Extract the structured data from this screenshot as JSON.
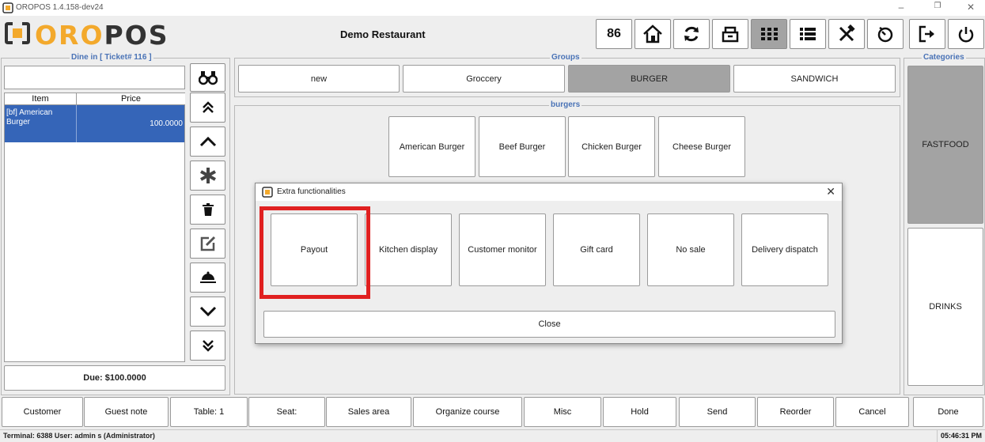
{
  "window": {
    "title": "OROPOS 1.4.158-dev24",
    "controls": [
      "–",
      "❐",
      "✕"
    ]
  },
  "header": {
    "logo_left": "ORO",
    "logo_right": "POS",
    "restaurant": "Demo Restaurant",
    "count_badge": "86",
    "icons": [
      "home-icon",
      "refresh-icon",
      "cashdrawer-icon",
      "grid-icon",
      "list-icon",
      "tools-icon",
      "timer-icon",
      "logout-icon",
      "power-icon"
    ],
    "brand_color": "#f3a92c"
  },
  "ticket": {
    "title": "Dine in [ Ticket# 116 ]",
    "search_value": "",
    "columns": [
      "Item",
      "Price"
    ],
    "rows": [
      {
        "item": "[bf] American Burger",
        "price": "100.0000"
      }
    ],
    "due": "Due: $100.0000",
    "selected_row_color": "#3565b8"
  },
  "groups": {
    "title": "Groups",
    "items": [
      "new",
      "Groccery",
      "BURGER",
      "SANDWICH"
    ],
    "selected": "BURGER"
  },
  "menu": {
    "title": "burgers",
    "items": [
      "American Burger",
      "Beef Burger",
      "Chicken Burger",
      "Cheese Burger"
    ]
  },
  "categories": {
    "title": "Categories",
    "items": [
      "FASTFOOD",
      "DRINKS"
    ],
    "selected": "FASTFOOD"
  },
  "dialog": {
    "title": "Extra functionalities",
    "buttons": [
      "Payout",
      "Kitchen display",
      "Customer monitor",
      "Gift card",
      "No sale",
      "Delivery dispatch"
    ],
    "close_label": "Close",
    "highlight_color": "#e02020"
  },
  "bottom_bar": {
    "buttons": [
      "Customer",
      "Guest note",
      "Table: 1",
      "Seat:",
      "Sales area",
      "Organize course",
      "Misc",
      "Hold",
      "Send",
      "Reorder",
      "Cancel",
      "Done"
    ]
  },
  "status": {
    "left": "Terminal: 6388  User: admin s (Administrator)",
    "time": "05:46:31 PM"
  }
}
